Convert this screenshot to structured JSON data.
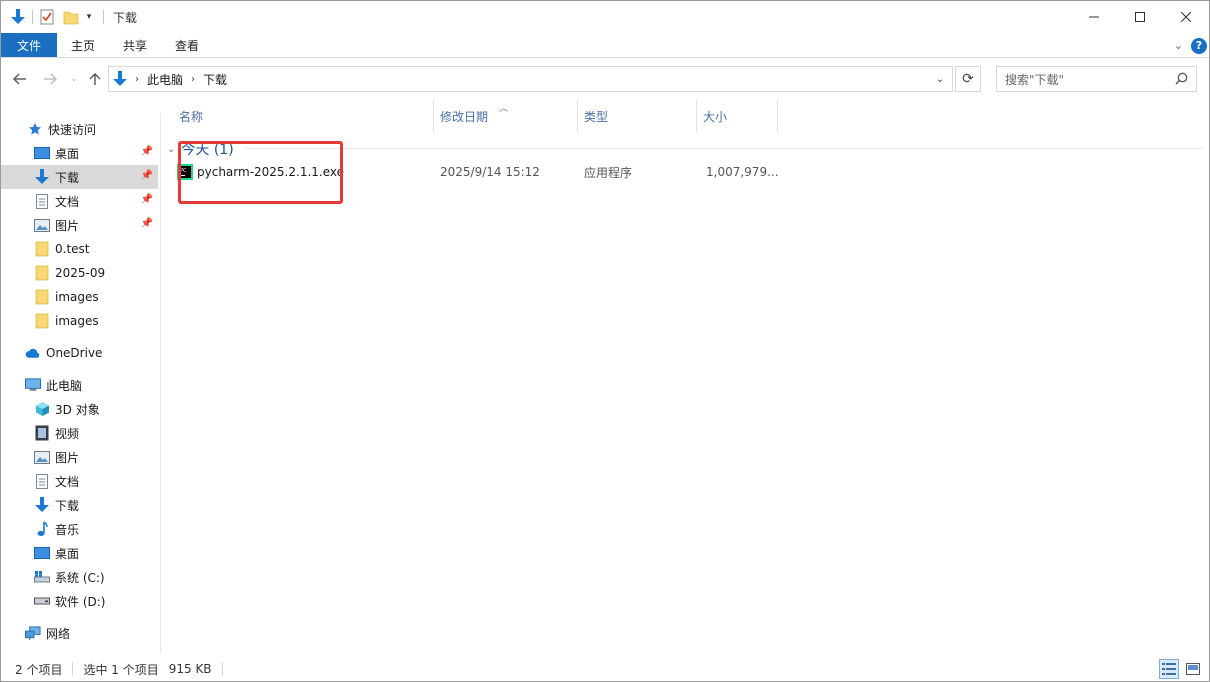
{
  "titlebar": {
    "title": "下载"
  },
  "ribbon": {
    "tabs": [
      "文件",
      "主页",
      "共享",
      "查看"
    ]
  },
  "address": {
    "crumbs": [
      "此电脑",
      "下载"
    ]
  },
  "search": {
    "placeholder": "搜索\"下载\""
  },
  "sidebar": {
    "items": [
      {
        "label": "快速访问",
        "icon": "star-icon",
        "pinned": false
      },
      {
        "label": "桌面",
        "icon": "desktop-icon",
        "pinned": true
      },
      {
        "label": "下载",
        "icon": "download-icon",
        "pinned": true,
        "selected": true
      },
      {
        "label": "文档",
        "icon": "document-icon",
        "pinned": true
      },
      {
        "label": "图片",
        "icon": "picture-icon",
        "pinned": true
      },
      {
        "label": "0.test",
        "icon": "folder-icon"
      },
      {
        "label": "2025-09",
        "icon": "folder-icon"
      },
      {
        "label": "images",
        "icon": "folder-icon"
      },
      {
        "label": "images",
        "icon": "folder-icon"
      },
      {
        "label": "OneDrive",
        "icon": "cloud-icon"
      },
      {
        "label": "此电脑",
        "icon": "computer-icon"
      },
      {
        "label": "3D 对象",
        "icon": "cube-icon"
      },
      {
        "label": "视频",
        "icon": "video-icon"
      },
      {
        "label": "图片",
        "icon": "picture-icon"
      },
      {
        "label": "文档",
        "icon": "document-icon"
      },
      {
        "label": "下载",
        "icon": "download-icon"
      },
      {
        "label": "音乐",
        "icon": "music-icon"
      },
      {
        "label": "桌面",
        "icon": "desktop-icon"
      },
      {
        "label": "系统 (C:)",
        "icon": "drive-icon"
      },
      {
        "label": "软件 (D:)",
        "icon": "drive-icon"
      },
      {
        "label": "网络",
        "icon": "network-icon"
      }
    ]
  },
  "columns": {
    "name": "名称",
    "date": "修改日期",
    "type": "类型",
    "size": "大小"
  },
  "group": {
    "label": "今天 (1)"
  },
  "files": [
    {
      "name": "pycharm-2025.2.1.1.exe",
      "date": "2025/9/14 15:12",
      "type": "应用程序",
      "size": "1,007,979..."
    }
  ],
  "status": {
    "count": "2 个项目",
    "selected": "选中 1 个项目",
    "size": "915 KB"
  },
  "colors": {
    "accent": "#1a6fc0",
    "highlight": "#e53935"
  }
}
